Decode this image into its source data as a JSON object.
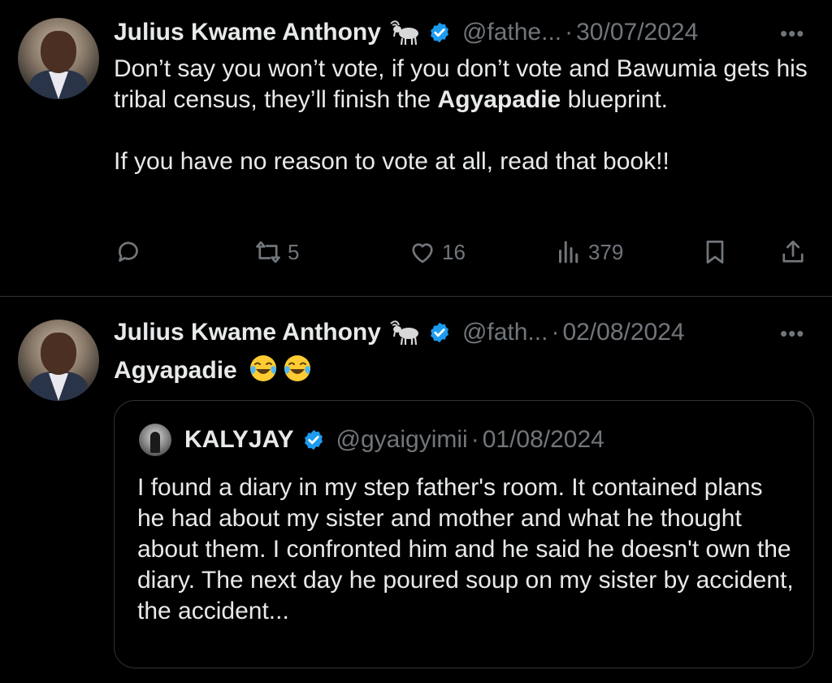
{
  "tweets": [
    {
      "author_name": "Julius Kwame Anthony",
      "handle": "@fathe...",
      "sep": "·",
      "date": "30/07/2024",
      "more": "•••",
      "text_part1": "Don’t say you won’t vote, if you don’t vote and Bawumia gets his tribal census, they’ll finish the ",
      "text_bold": "Agyapadie",
      "text_part2": " blueprint.",
      "text_para2": "If you have no reason to vote at all, read that book!!",
      "stats": {
        "retweets": "5",
        "likes": "16",
        "views": "379"
      }
    },
    {
      "author_name": "Julius Kwame Anthony",
      "handle": "@fath...",
      "sep": "·",
      "date": "02/08/2024",
      "more": "•••",
      "text_bold": "Agyapadie",
      "emoji": [
        "face-with-tears-of-joy",
        "face-with-tears-of-joy"
      ],
      "quote": {
        "author_name": "KALYJAY",
        "handle": "@gyaigyimii",
        "sep": "·",
        "date": "01/08/2024",
        "text": "I found a diary in my step father's room. It contained plans he had about my sister and mother and what he thought about  them. I confronted him and he said he doesn't own the diary. The next day he poured soup on my sister by accident, the accident..."
      }
    }
  ],
  "icons": {
    "reply": "speech-bubble-icon",
    "retweet": "retweet-icon",
    "like": "heart-icon",
    "views": "bar-chart-icon",
    "bookmark": "bookmark-icon",
    "share": "share-icon",
    "verified": "verified-badge-icon",
    "goat": "goat-emoji-icon"
  },
  "colors": {
    "background": "#000000",
    "text": "#e7e9ea",
    "secondary": "#71767b",
    "verified": "#1d9bf0",
    "border": "#2f3336"
  }
}
